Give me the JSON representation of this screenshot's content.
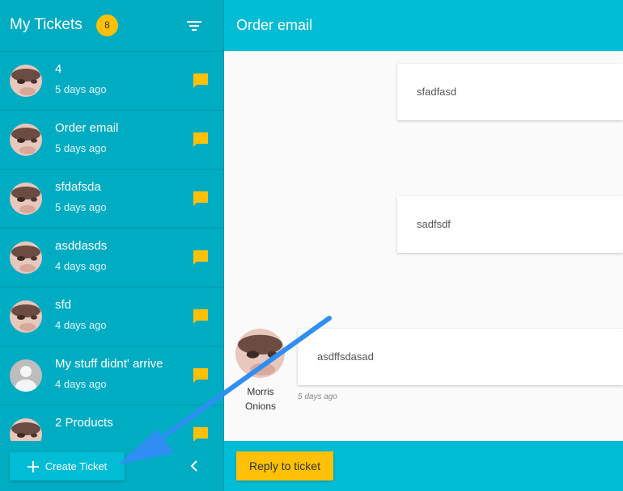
{
  "sidebar": {
    "title": "My Tickets",
    "badge_count": "8",
    "filter_icon": "filter-icon",
    "tickets": [
      {
        "title": "4",
        "time": "5 days ago",
        "avatar": "photo"
      },
      {
        "title": "Order email",
        "time": "5 days ago",
        "avatar": "photo"
      },
      {
        "title": "sfdafsda",
        "time": "5 days ago",
        "avatar": "photo"
      },
      {
        "title": "asddasds",
        "time": "4 days ago",
        "avatar": "photo"
      },
      {
        "title": "sfd",
        "time": "4 days ago",
        "avatar": "photo"
      },
      {
        "title": "My stuff didnt' arrive",
        "time": "4 days ago",
        "avatar": "default"
      },
      {
        "title": "2 Products",
        "time": "",
        "avatar": "photo"
      }
    ],
    "create_label": "Create Ticket"
  },
  "main": {
    "title": "Order email",
    "messages": [
      {
        "text": "sfadfasd"
      },
      {
        "text": "sadfsdf"
      },
      {
        "text": "asdffsdasad",
        "author": "Morris Onions",
        "time": "5 days ago"
      }
    ],
    "reply_label": "Reply to ticket"
  },
  "colors": {
    "sidebar": "#00acc1",
    "header": "#00bcd4",
    "accent": "#ffc107",
    "arrow": "#2f8ef4"
  }
}
